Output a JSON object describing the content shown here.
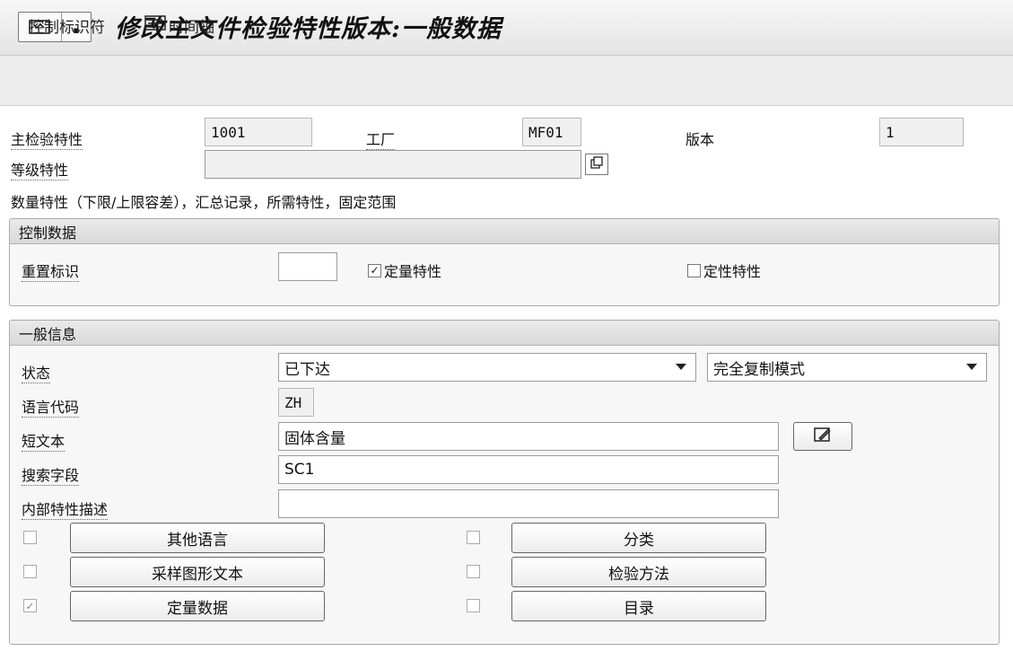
{
  "title": "修改主文件检验特性版本:一般数据",
  "toolbar": {
    "control_id": "控制标识符",
    "timeline": "时间轴"
  },
  "header": {
    "mic_label": "主检验特性",
    "mic_value": "1001",
    "plant_label": "工厂",
    "plant_value": "MF01",
    "version_label": "版本",
    "version_value": "1",
    "class_char_label": "等级特性",
    "class_char_value": ""
  },
  "summary_text": "数量特性（下限/上限容差），汇总记录，所需特性，固定范围",
  "control_data": {
    "title": "控制数据",
    "reset_label": "重置标识",
    "reset_value": "",
    "quantitative_label": "定量特性",
    "quantitative_checked": true,
    "qualitative_label": "定性特性",
    "qualitative_checked": false
  },
  "general": {
    "title": "一般信息",
    "status_label": "状态",
    "status_value": "已下达",
    "copy_mode_value": "完全复制模式",
    "language_label": "语言代码",
    "language_value": "ZH",
    "short_text_label": "短文本",
    "short_text_value": "固体含量",
    "search_label": "搜索字段",
    "search_value": "SC1",
    "internal_desc_label": "内部特性描述",
    "internal_desc_value": ""
  },
  "buttons": {
    "other_languages": "其他语言",
    "sampling_graphic": "采样图形文本",
    "quantitative_data": "定量数据",
    "classification": "分类",
    "inspection_method": "检验方法",
    "catalog": "目录"
  },
  "colors": {
    "toolbar_bg": "#ececec",
    "group_head": "#dddddd"
  }
}
